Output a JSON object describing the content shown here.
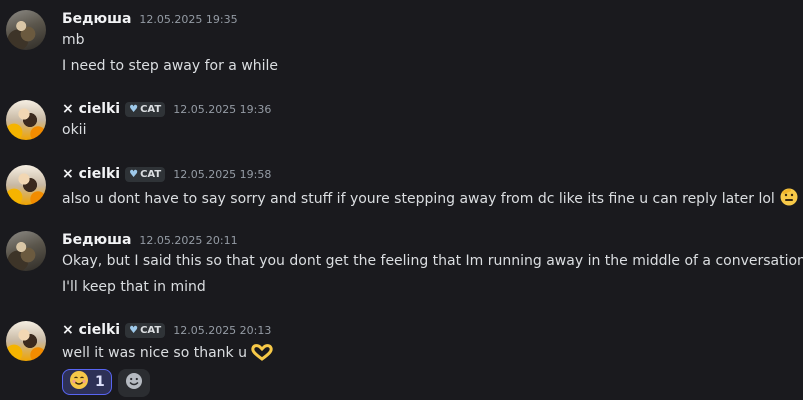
{
  "messages": [
    {
      "author": "Бедюша",
      "timestamp": "12.05.2025 19:35",
      "lines": [
        "mb",
        "I need to step away for a while"
      ]
    },
    {
      "author": "× cielki",
      "tag": "CAT",
      "timestamp": "12.05.2025 19:36",
      "lines": [
        "okii"
      ]
    },
    {
      "author": "× cielki",
      "tag": "CAT",
      "timestamp": "12.05.2025 19:58",
      "lines": [
        "also u dont have to say sorry and stuff if youre stepping away from dc like its fine u can reply later lol"
      ],
      "trailing_emoji": "saluting-face-icon"
    },
    {
      "author": "Бедюша",
      "timestamp": "12.05.2025 20:11",
      "lines": [
        "Okay, but I said this so that you dont get the feeling that Im running away in the middle of a conversation",
        "I'll keep that in mind"
      ]
    },
    {
      "author": "× cielki",
      "tag": "CAT",
      "timestamp": "12.05.2025 20:13",
      "lines": [
        "well it was nice so thank u"
      ],
      "trailing_emoji": "heart-hands-icon",
      "reaction": {
        "emoji": "smiling-face-icon",
        "count": "1"
      }
    }
  ],
  "colors": {
    "background": "#1a1a1e",
    "username": "#f2f3f5",
    "text": "#dbdee1",
    "timestamp": "#949ba4",
    "reaction_border": "#5865f2"
  }
}
